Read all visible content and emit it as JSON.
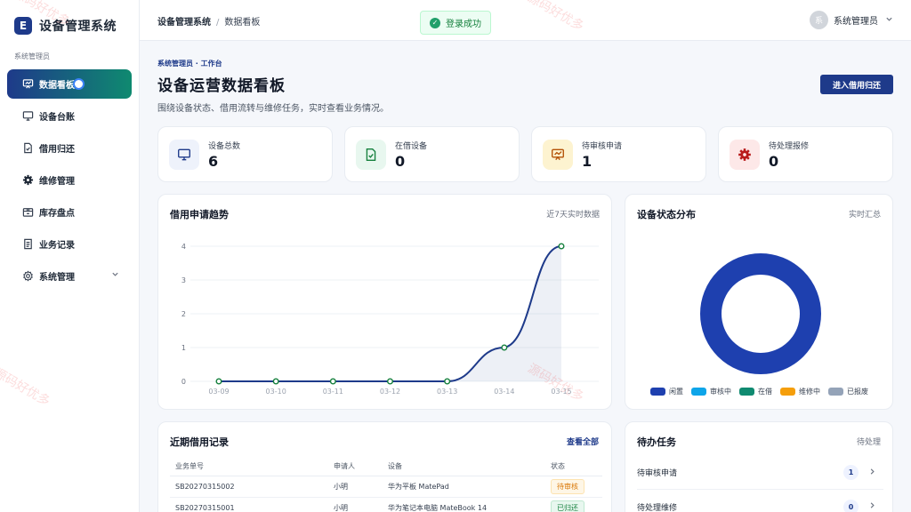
{
  "app": {
    "logo_letter": "E",
    "title": "设备管理系统",
    "role_label": "系统管理员"
  },
  "sidebar": {
    "items": [
      {
        "label": "数据看板",
        "icon": "chart-board-icon"
      },
      {
        "label": "设备台账",
        "icon": "monitor-icon"
      },
      {
        "label": "借用归还",
        "icon": "document-check-icon"
      },
      {
        "label": "维修管理",
        "icon": "gear-icon"
      },
      {
        "label": "库存盘点",
        "icon": "box-icon"
      },
      {
        "label": "业务记录",
        "icon": "list-document-icon"
      },
      {
        "label": "系统管理",
        "icon": "settings-icon"
      }
    ]
  },
  "topbar": {
    "breadcrumb_root": "设备管理系统",
    "breadcrumb_sep": "/",
    "breadcrumb_current": "数据看板",
    "toast": "登录成功",
    "user_avatar": "系",
    "user_name": "系统管理员"
  },
  "header": {
    "kicker": "系统管理员 · 工作台",
    "title": "设备运营数据看板",
    "desc": "围绕设备状态、借用流转与维修任务，实时查看业务情况。",
    "action": "进入借用归还"
  },
  "stats": [
    {
      "label": "设备总数",
      "value": "6",
      "icon": "monitor-icon",
      "color": "#1e3a8a",
      "bg": "#eef2fb"
    },
    {
      "label": "在借设备",
      "value": "0",
      "icon": "document-check-icon",
      "color": "#15803d",
      "bg": "#e8f7ef"
    },
    {
      "label": "待审核申请",
      "value": "1",
      "icon": "easel-icon",
      "color": "#b45309",
      "bg": "#fdf3d0"
    },
    {
      "label": "待处理报修",
      "value": "0",
      "icon": "gear-icon",
      "color": "#b91c1c",
      "bg": "#fde8e8"
    }
  ],
  "trend": {
    "title": "借用申请趋势",
    "sub": "近7天实时数据"
  },
  "status": {
    "title": "设备状态分布",
    "sub": "实时汇总"
  },
  "records": {
    "title": "近期借用记录",
    "link": "查看全部",
    "headers": [
      "业务单号",
      "申请人",
      "设备",
      "状态"
    ],
    "rows": [
      {
        "no": "SB20270315002",
        "applicant": "小明",
        "device": "华为平板 MatePad",
        "status": "待审核"
      },
      {
        "no": "SB20270315001",
        "applicant": "小明",
        "device": "华为笔记本电脑 MateBook 14",
        "status": "已归还"
      }
    ]
  },
  "todo": {
    "title": "待办任务",
    "sub": "待处理",
    "items": [
      {
        "label": "待审核申请",
        "count": "1"
      },
      {
        "label": "待处理维修",
        "count": "0"
      }
    ]
  },
  "watermark": "源码好优多",
  "chart_data": [
    {
      "type": "line",
      "title": "借用申请趋势",
      "x": [
        "03-09",
        "03-10",
        "03-11",
        "03-12",
        "03-13",
        "03-14",
        "03-15"
      ],
      "series": [
        {
          "values": [
            0,
            0,
            0,
            0,
            0,
            1,
            4
          ]
        }
      ],
      "ylim": [
        0,
        4
      ],
      "yticks": [
        0,
        1,
        2,
        3,
        4
      ],
      "grid": true,
      "color": "#1e3a8a"
    },
    {
      "type": "pie",
      "title": "设备状态分布",
      "donut": true,
      "labels": [
        "闲置",
        "审核中",
        "在借",
        "维修中",
        "已报废"
      ],
      "values": [
        6,
        0,
        0,
        0,
        0
      ],
      "colors": [
        "#1e40af",
        "#0ea5e9",
        "#0f8a70",
        "#f59e0b",
        "#94a3b8"
      ],
      "legend": "bottom"
    }
  ]
}
